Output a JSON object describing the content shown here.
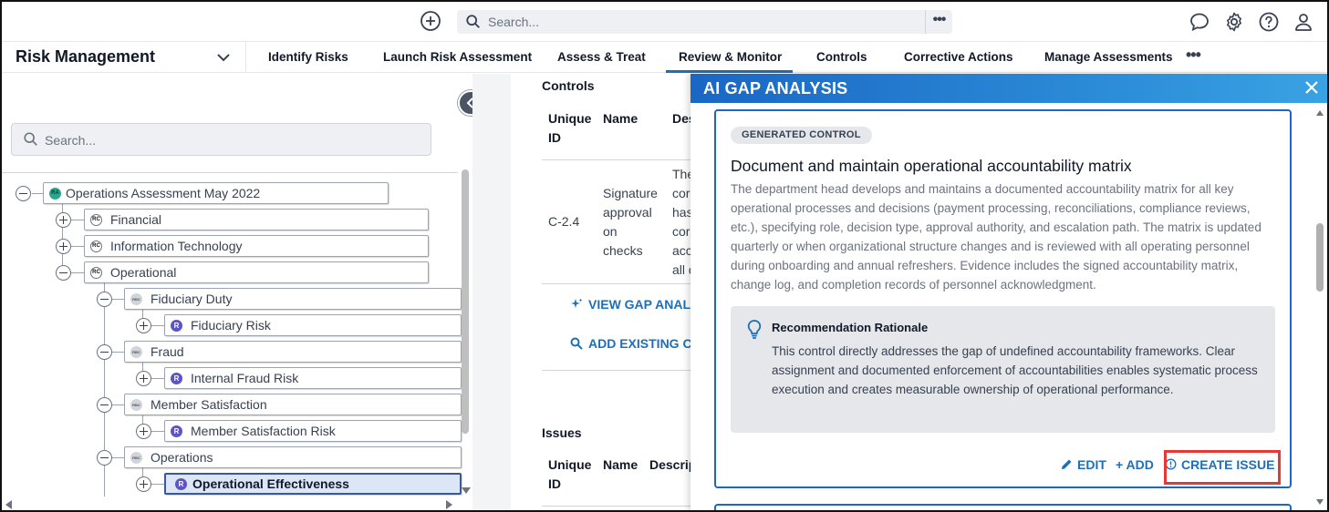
{
  "topbar": {
    "search_placeholder": "Search...",
    "more_label": "•••",
    "icons": [
      "add-circle-icon",
      "search-icon",
      "chat-bubble-icon",
      "gear-icon",
      "help-icon",
      "user-icon"
    ]
  },
  "module": {
    "title": "Risk Management"
  },
  "nav": {
    "tabs": [
      {
        "label": "Identify Risks"
      },
      {
        "label": "Launch Risk Assessment"
      },
      {
        "label": "Assess & Treat"
      },
      {
        "label": "Review & Monitor",
        "active": true
      },
      {
        "label": "Controls"
      },
      {
        "label": "Corrective Actions"
      },
      {
        "label": "Manage Assessments"
      }
    ],
    "more_label": "•••"
  },
  "tree": {
    "search_placeholder": "Search...",
    "nodes": [
      {
        "badge": "RA",
        "label": "Operations Assessment May 2022",
        "expanded": true
      },
      {
        "badge": "RC",
        "label": "Financial",
        "expanded": false
      },
      {
        "badge": "RC",
        "label": "Information Technology",
        "expanded": false
      },
      {
        "badge": "RC",
        "label": "Operational",
        "expanded": true
      },
      {
        "badge": "RBC",
        "label": "Fiduciary Duty",
        "expanded": true
      },
      {
        "badge": "R",
        "label": "Fiduciary Risk",
        "expanded": false
      },
      {
        "badge": "RBC",
        "label": "Fraud",
        "expanded": true
      },
      {
        "badge": "R",
        "label": "Internal Fraud Risk",
        "expanded": false
      },
      {
        "badge": "RBC",
        "label": "Member Satisfaction",
        "expanded": true
      },
      {
        "badge": "R",
        "label": "Member Satisfaction Risk",
        "expanded": false
      },
      {
        "badge": "RBC",
        "label": "Operations",
        "expanded": true
      },
      {
        "badge": "R",
        "label": "Operational Effectiveness",
        "expanded": false,
        "selected": true
      }
    ]
  },
  "controls": {
    "heading": "Controls",
    "col_unique_line1": "Unique",
    "col_unique_line2": "ID",
    "col_name": "Name",
    "col_desc_partial": "Des",
    "row": {
      "id": "C-2.4",
      "name_lines": [
        "Signature",
        "approval",
        "on",
        "checks"
      ],
      "desc_partial_lines": [
        "The",
        "cor",
        "has",
        "cor",
        "acc",
        "all d"
      ]
    },
    "view_gap_label": "VIEW GAP ANAL",
    "add_existing_label": "ADD EXISTING C"
  },
  "issues": {
    "heading": "Issues",
    "col_unique_line1": "Unique",
    "col_unique_line2": "ID",
    "col_name": "Name",
    "col_desc_partial": "Descrip"
  },
  "ai_panel": {
    "title": "AI GAP ANALYSIS",
    "card": {
      "chip": "GENERATED CONTROL",
      "title": "Document and maintain operational accountability matrix",
      "description": "The department head develops and maintains a documented accountability matrix for all key operational processes and decisions (payment processing, reconciliations, compliance reviews, etc.), specifying role, decision type, approval authority, and escalation path. The matrix is updated quarterly or when organizational structure changes and is reviewed with all operating personnel during onboarding and annual refreshers. Evidence includes the signed accountability matrix, change log, and completion records of personnel acknowledgment.",
      "rationale_title": "Recommendation Rationale",
      "rationale_text": "This control directly addresses the gap of undefined accountability frameworks. Clear assignment and documented enforcement of accountabilities enables systematic process execution and creates measurable ownership of operational performance.",
      "edit_label": "EDIT",
      "add_label": "+ ADD",
      "create_issue_label": "CREATE ISSUE"
    }
  },
  "colors": {
    "accent": "#1d6fb8",
    "header_gradient_start": "#1a67c4",
    "header_gradient_end": "#3aa3e4",
    "highlight": "#e53935",
    "selected_node": "#dbe6f7"
  }
}
